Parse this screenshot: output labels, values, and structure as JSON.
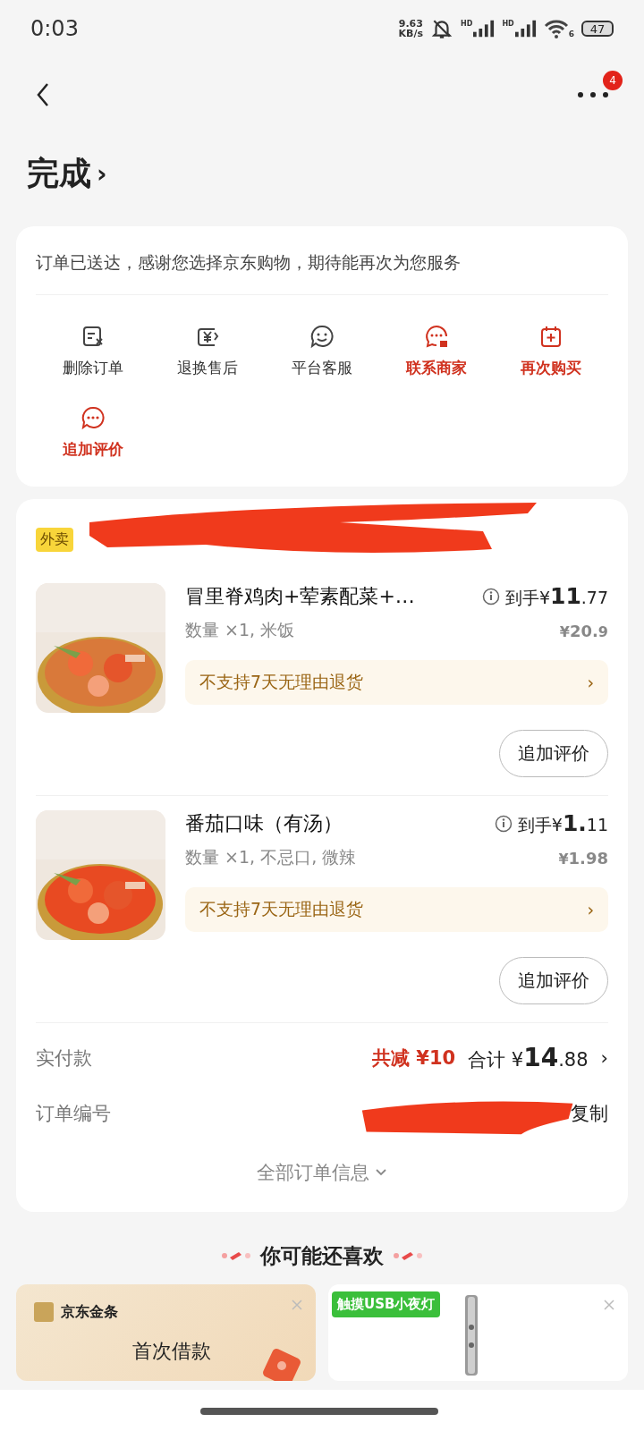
{
  "status_bar": {
    "time": "0:03",
    "speed_value": "9.63",
    "speed_unit": "KB/s",
    "sim_labels": [
      "HD",
      "HD"
    ],
    "wifi_label": "6",
    "battery": "47"
  },
  "nav": {
    "badge": "4"
  },
  "title": "完成",
  "title_chevron": "›",
  "status_card": {
    "message": "订单已送达，感谢您选择京东购物，期待能再次为您服务",
    "actions": [
      {
        "label": "删除订单",
        "highlighted": false
      },
      {
        "label": "退换售后",
        "highlighted": false
      },
      {
        "label": "平台客服",
        "highlighted": false
      },
      {
        "label": "联系商家",
        "highlighted": true
      },
      {
        "label": "再次购买",
        "highlighted": true
      },
      {
        "label": "追加评价",
        "highlighted": true
      }
    ]
  },
  "order": {
    "store_tag": "外卖",
    "items": [
      {
        "name": "冒里脊鸡肉+荤素配菜+…",
        "net_prefix": "到手¥",
        "net_main": "11",
        "net_fraction": ".77",
        "options": "数量 ×1, 米饭",
        "price_prefix": "¥",
        "price_main": "20.",
        "price_fraction": "9",
        "notice": "不支持7天无理由退货",
        "notice_chevron": "›",
        "review_button": "追加评价"
      },
      {
        "name": "番茄口味（有汤）",
        "net_prefix": "到手¥",
        "net_main": "1.",
        "net_fraction": "11",
        "options": "数量 ×1, 不忌口, 微辣",
        "price_prefix": "¥",
        "price_main": "1.98",
        "notice": "不支持7天无理由退货",
        "notice_chevron": "›",
        "review_button": "追加评价"
      }
    ],
    "paid_label": "实付款",
    "discount": "共减 ¥10",
    "total_prefix": "合计 ¥",
    "total_main": "14",
    "total_fraction": ".88",
    "total_chevron": "›",
    "order_no_label": "订单编号",
    "copy_button": "复制",
    "more_info": "全部订单信息"
  },
  "recommend": {
    "heading": "你可能还喜欢",
    "cards": [
      {
        "kind": "promo",
        "brand": "京东金条",
        "headline": "首次借款"
      },
      {
        "kind": "product",
        "tag": "触摸USB小夜灯"
      }
    ]
  }
}
